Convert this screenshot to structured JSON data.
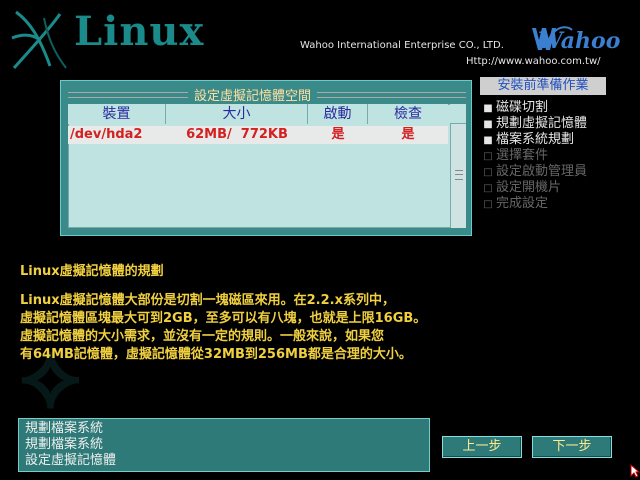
{
  "header": {
    "product": "Linux",
    "company": "Wahoo International Enterprise CO., LTD.",
    "url": "Http://www.wahoo.com.tw/",
    "brand": "Wahoo",
    "accent_color": "#1a8a8a"
  },
  "panel": {
    "title": "設定虛擬記憶體空間",
    "columns": [
      "裝置",
      "大小",
      "啟動",
      "檢查"
    ],
    "rows": [
      {
        "device": "/dev/hda2",
        "size": "62MB/  772KB",
        "active": "是",
        "check": "是"
      }
    ]
  },
  "steps": {
    "title": "安裝前準備作業",
    "items": [
      {
        "label": "磁碟切割",
        "state": "done"
      },
      {
        "label": "規劃虛擬記憶體",
        "state": "done"
      },
      {
        "label": "檔案系統規劃",
        "state": "done"
      },
      {
        "label": "選擇套件",
        "state": "pending"
      },
      {
        "label": "設定啟動管理員",
        "state": "pending"
      },
      {
        "label": "設定開機片",
        "state": "pending"
      },
      {
        "label": "完成設定",
        "state": "pending"
      }
    ]
  },
  "help": {
    "title": "Linux虛擬記憶體的規劃",
    "lines": [
      "Linux虛擬記憶體大部份是切割一塊磁區來用。在2.2.x系列中，",
      "虛擬記憶體區塊最大可到2GB，至多可以有八塊，也就是上限16GB。",
      "虛擬記憶體的大小需求，並沒有一定的規則。一般來說，如果您",
      "有64MB記憶體，虛擬記憶體從32MB到256MB都是合理的大小。"
    ]
  },
  "log": {
    "lines": [
      "規劃檔案系統",
      "規劃檔案系統",
      "設定虛擬記憶體"
    ]
  },
  "buttons": {
    "prev": "上一步",
    "next": "下一步"
  }
}
